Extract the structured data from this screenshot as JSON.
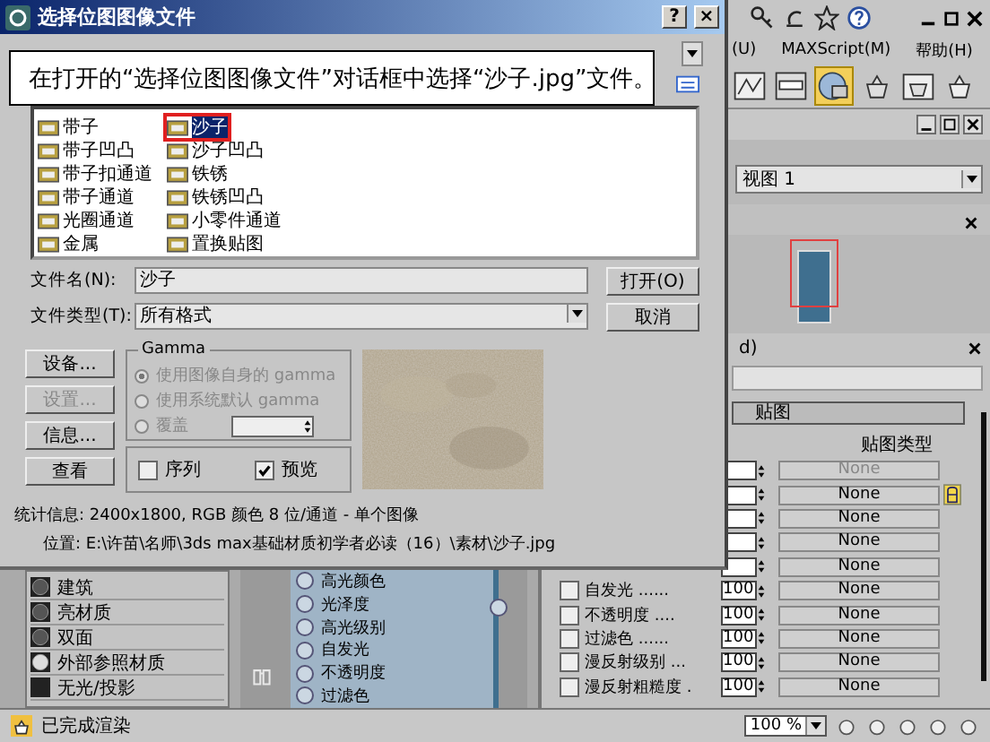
{
  "dialog": {
    "title": "选择位图图像文件",
    "help": "?",
    "close": "×",
    "files": [
      {
        "name": "带子",
        "selected": false
      },
      {
        "name": "带子凹凸",
        "selected": false
      },
      {
        "name": "带子扣通道",
        "selected": false
      },
      {
        "name": "带子通道",
        "selected": false
      },
      {
        "name": "光圈通道",
        "selected": false
      },
      {
        "name": "金属",
        "selected": false
      },
      {
        "name": "沙子",
        "selected": true
      },
      {
        "name": "沙子凹凸",
        "selected": false
      },
      {
        "name": "铁锈",
        "selected": false
      },
      {
        "name": "铁锈凹凸",
        "selected": false
      },
      {
        "name": "小零件通道",
        "selected": false
      },
      {
        "name": "置换贴图",
        "selected": false
      }
    ],
    "filename_label": "文件名(N):",
    "filename": "沙子",
    "filetype_label": "文件类型(T):",
    "filetype": "所有格式",
    "buttons": [
      "打开(O)",
      "取消"
    ],
    "side_buttons": [
      {
        "label": "设备...",
        "disabled": false
      },
      {
        "label": "设置...",
        "disabled": true
      },
      {
        "label": "信息...",
        "disabled": false
      },
      {
        "label": "查看",
        "disabled": false
      }
    ],
    "gamma": {
      "title": "Gamma",
      "disabled": true,
      "options": [
        {
          "label": "使用图像自身的 gamma",
          "selected": true
        },
        {
          "label": "使用系统默认 gamma",
          "selected": false
        },
        {
          "label": "覆盖",
          "selected": false
        }
      ]
    },
    "checkboxes": [
      {
        "label": "序列",
        "checked": false
      },
      {
        "label": "预览",
        "checked": true
      }
    ],
    "preview": {
      "kind": "picture"
    },
    "stats": "统计信息: 2400x1800, RGB 颜色 8 位/通道 - 单个图像",
    "location": "位置: E:\\许苗\\名师\\3ds max基础材质初学者必读（16）\\素材\\沙子.jpg"
  },
  "callout": "在打开的“选择位图图像文件”对话框中选择“沙子.jpg”文件。",
  "app": {
    "menu": [
      "(U)",
      "MAXScript(M)",
      "帮助(H)"
    ],
    "viewport": "视图 1",
    "panel_title": "d)",
    "rollout": "贴图",
    "map_header": "贴图类型",
    "map_rows": [
      {
        "map": "None",
        "disabled": true
      },
      {
        "map": "None",
        "disabled": false
      },
      {
        "map": "None",
        "disabled": false
      },
      {
        "map": "None",
        "disabled": false
      },
      {
        "map": "None",
        "disabled": false
      },
      {
        "label": "自发光 ......",
        "value": "100",
        "map": "None",
        "checked": false,
        "disabled": false
      },
      {
        "label": "不透明度 ....",
        "value": "100",
        "map": "None",
        "checked": false,
        "disabled": false
      },
      {
        "label": "过滤色 ......",
        "value": "100",
        "map": "None",
        "checked": false,
        "disabled": false
      },
      {
        "label": "漫反射级别 ...",
        "value": "100",
        "map": "None",
        "checked": false,
        "disabled": false
      },
      {
        "label": "漫反射粗糙度 .",
        "value": "100",
        "map": "None",
        "checked": false,
        "disabled": false
      }
    ],
    "materials": [
      "建筑",
      "亮材质",
      "双面",
      "外部参照材质",
      "无光/投影"
    ],
    "nodes": [
      "高光颜色",
      "光泽度",
      "高光级别",
      "自发光",
      "不透明度",
      "过滤色"
    ],
    "status": "已完成渲染",
    "zoom": "100 %"
  }
}
